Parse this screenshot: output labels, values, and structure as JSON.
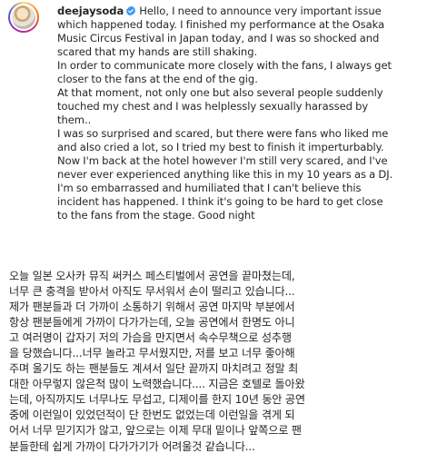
{
  "post": {
    "username": "deejaysoda",
    "verified_icon": "verified-badge-icon",
    "accent_color": "#3897f0",
    "english_caption_first_line_suffix": "Hello, I need to announce very important issue",
    "english_lines": [
      "which happened today. I finished my performance at the Osaka",
      "Music Circus Festival in Japan today, and I was so shocked and",
      "scared that my hands are still shaking.",
      "In order to communicate more closely with the fans, I always get",
      "closer to the fans at the end of the gig.",
      "At that moment, not only one but also several people suddenly",
      "touched my chest and I was helplessly sexually harassed by",
      "them..",
      "I was so surprised and scared, but there were fans who liked me",
      "and also cried a lot, so I tried my best to finish it imperturbably.",
      "Now I'm back at the hotel however I'm still very scared, and I've",
      "never ever experienced anything like this in my 10 years as a DJ.",
      "I'm so embarrassed and humiliated that I can't believe this",
      "incident has happened. I think it's going to be hard to get close",
      "to the fans from the stage. Good night"
    ],
    "korean_lines": [
      "오늘 일본 오사카 뮤직 써커스 페스티벌에서 공연을 끝마쳤는데,",
      "너무 큰 충격을 받아서 아직도 무서워서 손이 떨리고 있습니다...",
      "제가 팬분들과 더 가까이 소통하기 위해서 공연 마지막 부분에서",
      "항상 팬분들에게 가까이 다가가는데, 오늘 공연에서 한명도 아니",
      "고 여러명이 갑자기 저의 가슴을 만지면서 속수무책으로 성추행",
      "을 당했습니다...너무 놀라고 무서웠지만, 저를 보고 너무 좋아해",
      "주며 울기도 하는 팬분들도 계셔서 일단 끝까지 마치려고 정말 최",
      "대한 아무렇지 않은척 많이 노력했습니다.... 지금은 호텔로 돌아왔",
      "는데, 아직까지도 너무나도 무섭고, 디제이를 한지 10년 동안 공연",
      "중에 이런일이 있었던적이 단 한번도 없었는데 이런일을 겪게 되",
      "어서 너무 믿기지가 않고, 앞으로는 이제 무대 밑이나 앞쪽으로 팬",
      "분들한테 쉽게 가까이 다가가기가 어려울것 같습니다..."
    ]
  }
}
